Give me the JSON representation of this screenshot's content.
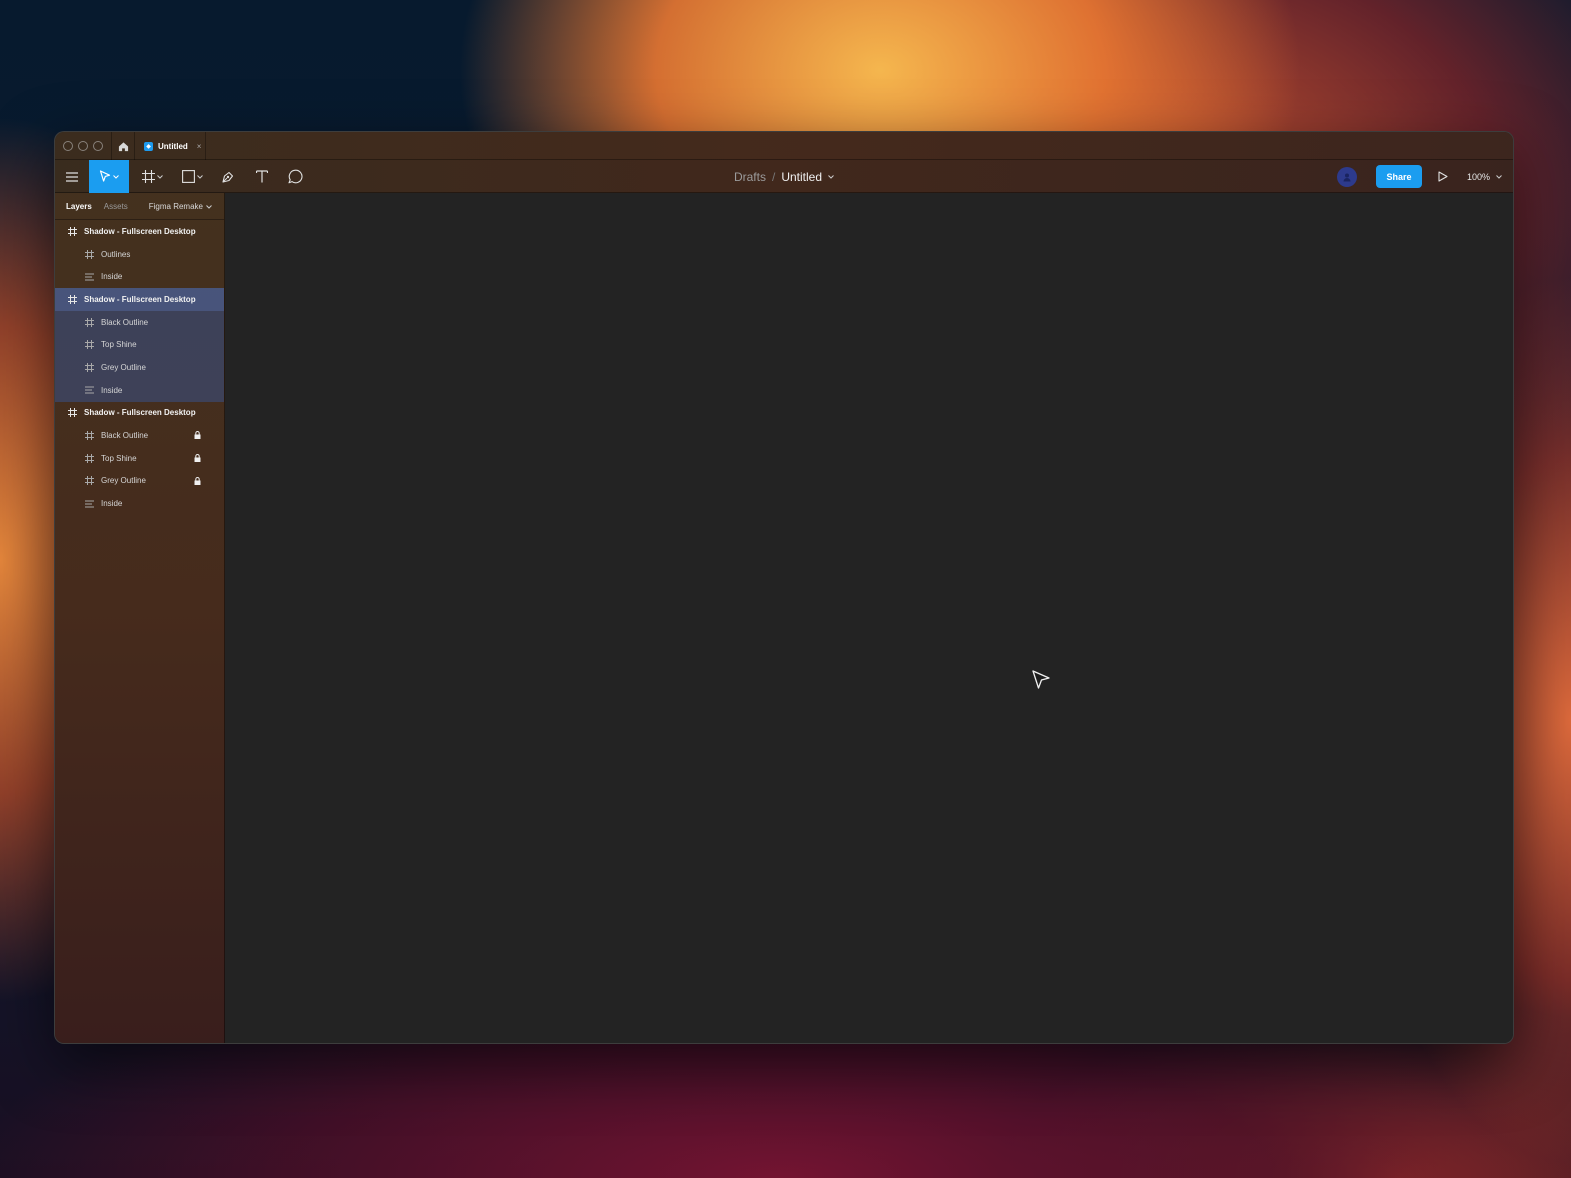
{
  "titlebar": {
    "tab": {
      "title": "Untitled",
      "close_glyph": "×",
      "favicon": "figma-file-icon"
    }
  },
  "toolbar": {
    "breadcrumb": {
      "parent": "Drafts",
      "separator": "/",
      "file": "Untitled"
    },
    "share_label": "Share",
    "zoom_label": "100%"
  },
  "panel": {
    "tabs": {
      "layers": "Layers",
      "assets": "Assets"
    },
    "page": "Figma Remake",
    "layers": [
      {
        "label": "Shadow - Fullscreen Desktop",
        "kind": "frame",
        "level": 0,
        "selected": false
      },
      {
        "label": "Outlines",
        "kind": "frame",
        "level": 1,
        "selected": false
      },
      {
        "label": "Inside",
        "kind": "text",
        "level": 1,
        "selected": false
      },
      {
        "label": "Shadow - Fullscreen Desktop",
        "kind": "frame",
        "level": 0,
        "selected": true
      },
      {
        "label": "Black Outline",
        "kind": "frame",
        "level": 1,
        "selected": true
      },
      {
        "label": "Top Shine",
        "kind": "frame",
        "level": 1,
        "selected": true
      },
      {
        "label": "Grey Outline",
        "kind": "frame",
        "level": 1,
        "selected": true
      },
      {
        "label": "Inside",
        "kind": "text",
        "level": 1,
        "selected": true
      },
      {
        "label": "Shadow - Fullscreen Desktop",
        "kind": "frame",
        "level": 0,
        "selected": false
      },
      {
        "label": "Black Outline",
        "kind": "frame",
        "level": 1,
        "selected": false,
        "locked": true
      },
      {
        "label": "Top Shine",
        "kind": "frame",
        "level": 1,
        "selected": false,
        "locked": true
      },
      {
        "label": "Grey Outline",
        "kind": "frame",
        "level": 1,
        "selected": false,
        "locked": true
      },
      {
        "label": "Inside",
        "kind": "text",
        "level": 1,
        "selected": false
      }
    ]
  },
  "colors": {
    "accent": "#1b9df0",
    "canvas": "#232323",
    "selection": "#4a629b"
  }
}
